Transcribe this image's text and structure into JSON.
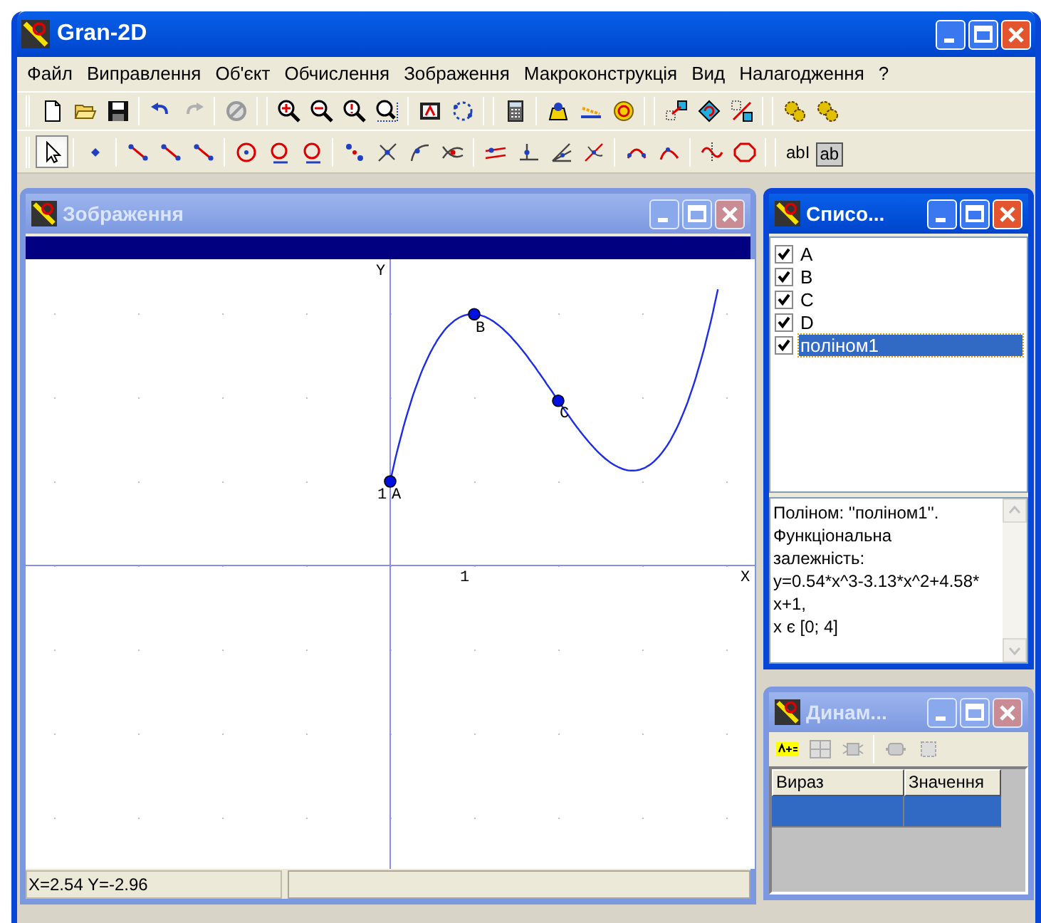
{
  "window": {
    "title": "Gran-2D"
  },
  "menu": [
    {
      "label": "Файл"
    },
    {
      "label": "Виправлення"
    },
    {
      "label": "Об'єкт"
    },
    {
      "label": "Обчислення"
    },
    {
      "label": "Зображення"
    },
    {
      "label": "Макроконструкція"
    },
    {
      "label": "Вид"
    },
    {
      "label": "Налагодження"
    },
    {
      "label": "?"
    }
  ],
  "pointer_tool": {
    "selected": true
  },
  "text_tools": [
    "abI",
    "ab"
  ],
  "drawing_window": {
    "title": "Зображення",
    "active": false,
    "y_axis_label": "Y",
    "x_axis_label": "X",
    "x_tick": "1",
    "y_tick": "1",
    "points": [
      {
        "label": "A"
      },
      {
        "label": "B"
      },
      {
        "label": "C"
      }
    ],
    "status": "X=2.54 Y=-2.96"
  },
  "list_window": {
    "title": "Списо...",
    "active": true,
    "items": [
      {
        "label": "A",
        "checked": true,
        "selected": false
      },
      {
        "label": "B",
        "checked": true,
        "selected": false
      },
      {
        "label": "C",
        "checked": true,
        "selected": false
      },
      {
        "label": "D",
        "checked": true,
        "selected": false
      },
      {
        "label": "поліном1",
        "checked": true,
        "selected": true
      }
    ],
    "info": [
      "Поліном: ''поліном1''.",
      "Функціональна",
      "залежність:",
      "y=0.54*x^3-3.13*x^2+4.58*",
      "x+1,",
      "x є [0; 4]"
    ]
  },
  "dynamic_window": {
    "title": "Динам...",
    "active": false,
    "columns": [
      "Вираз",
      "Значення"
    ],
    "rows": [
      {
        "selected": true
      }
    ]
  }
}
